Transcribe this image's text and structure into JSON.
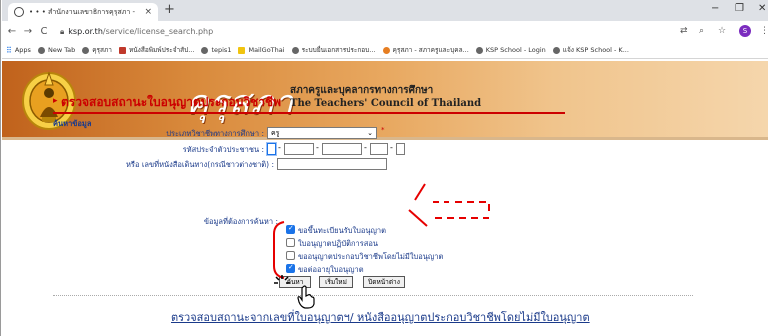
{
  "browser": {
    "tab_title": "• • • สำนักงานเลขาธิการคุรุสภา - ",
    "tab_close": "×",
    "new_tab": "+",
    "window_controls": [
      "−",
      "❐",
      "✕"
    ],
    "nav_icons": [
      "←",
      "→",
      "C"
    ],
    "url_host": "ksp.or.th",
    "url_path": "/service/license_search.php",
    "profile_initial": "S",
    "bookmarks": [
      {
        "label": "Apps",
        "icon": "apps-icon"
      },
      {
        "label": "New Tab",
        "icon": "globe-icon"
      },
      {
        "label": "คุรุสภา",
        "icon": "globe-icon"
      },
      {
        "label": "หนังสือพิมพ์ประจำสัป...",
        "icon": "news-icon"
      },
      {
        "label": "tepis1",
        "icon": "globe-icon"
      },
      {
        "label": "MailGoThai",
        "icon": "mail-icon"
      },
      {
        "label": "ระบบยื่นเอกสารประกอบ...",
        "icon": "globe-icon"
      },
      {
        "label": "คุรุสภา - สภาครูและบุคล...",
        "icon": "orange-icon"
      },
      {
        "label": "KSP School - Login",
        "icon": "globe-icon"
      },
      {
        "label": "แจ้ง KSP School - K...",
        "icon": "globe-icon"
      }
    ]
  },
  "banner": {
    "logo_thai": "คุรุสภา",
    "council_th": "สภาครูและบุคลากรทางการศึกษา",
    "council_en": "The Teachers' Council of Thailand"
  },
  "form": {
    "heading": "ตรวจสอบสถานะใบอนุญาตประกอบวิชาชีพ",
    "subheading": "ค้นหาข้อมูล",
    "profession_label": "ประเภทวิชาชีพทางการศึกษา :",
    "profession_value": "ครู",
    "required_mark": "*",
    "id_label": "รหัสประจำตัวประชาชน :",
    "passport_label": "หรือ เลขที่หนังสือเดินทาง(กรณีชาวต่างชาติ) :",
    "lookup_label": "ข้อมูลที่ต้องการค้นหา :",
    "options": [
      {
        "label": "ขอขึ้นทะเบียนรับใบอนุญาต",
        "checked": true
      },
      {
        "label": "ใบอนุญาตปฏิบัติการสอน",
        "checked": false
      },
      {
        "label": "ขออนุญาตประกอบวิชาชีพโดยไม่มีใบอนุญาต",
        "checked": false
      },
      {
        "label": "ขอต่ออายุใบอนุญาต",
        "checked": true
      }
    ],
    "buttons": [
      "ค้นหา",
      "เริ่มใหม่",
      "ปิดหน้าต่าง"
    ]
  },
  "bottom_link": "ตรวจสอบสถานะจากเลขที่ใบอนุญาตฯ/ หนังสืออนุญาตประกอบวิชาชีพโดยไม่มีใบอนุญาต",
  "colors": {
    "heading_red": "#cc0000",
    "form_blue": "#1a3a8a",
    "annotation_red": "#e60000",
    "banner_orange": "#d98a3c"
  }
}
